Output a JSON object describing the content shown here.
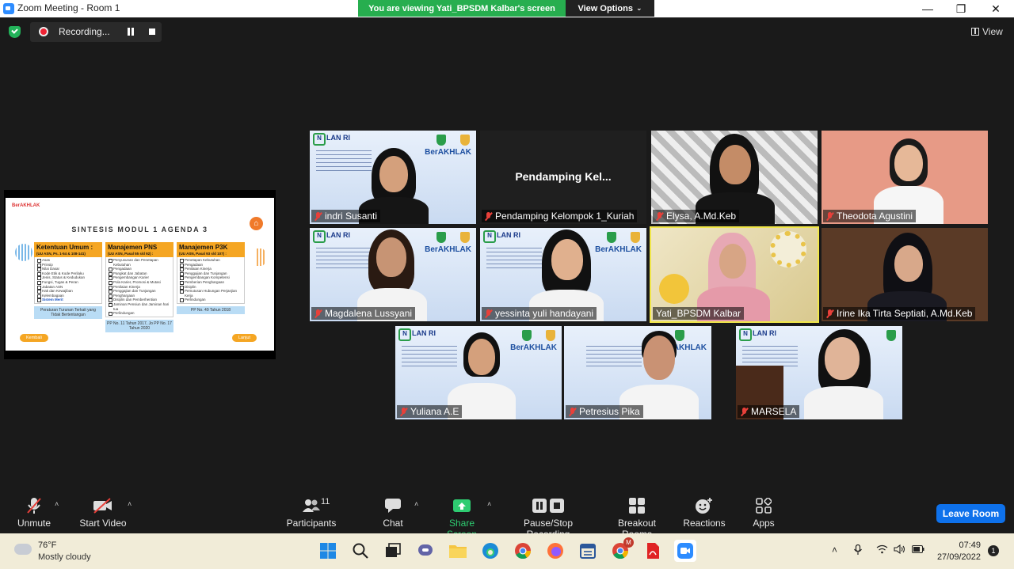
{
  "window": {
    "title": "Zoom Meeting - Room 1",
    "viewing_banner": "You are viewing Yati_BPSDM Kalbar's screen",
    "view_options": "View Options",
    "minimize": "—",
    "maximize": "❐",
    "close": "✕"
  },
  "recording": {
    "label": "Recording..."
  },
  "view_button": "View",
  "shared_slide": {
    "logo_text": "BerAKHLAK",
    "title": "SINTESIS MODUL 1 AGENDA 3",
    "columns": [
      {
        "heading": "Ketentuan Umum :",
        "subheading": "(UU ASN, Ps. 1-54 & 108-141)",
        "items": [
          "Asas",
          "Prinsip",
          "Nilai Dasar",
          "Kode Etik & Kode Perilaku",
          "Jenis, Status & Kedudukan",
          "Fungsi, Tugas & Peran",
          "Jabatan ASN",
          "Hak dan Kewajiban",
          "Kelembagaan",
          "Sistem Merit"
        ],
        "highlight": "Sistem Merit",
        "footer": "Peraturan Turunan Terkait yang Tidak Bertentangan"
      },
      {
        "heading": "Manajemen PNS",
        "subheading": "(UU ASN, Pasal 55 s/d 92) :",
        "items": [
          "Penyusunan dan Penetapan Kebutuhan",
          "Pengadaan",
          "Pangkat dan Jabatan",
          "Pengembangan Karier",
          "Pola Karier, Promosi & Mutasi",
          "Penilaian Kinerja",
          "Penggajian dan Tunjangan",
          "Penghargaan",
          "Disiplin dan Pemberhentian",
          "Jaminan Pensiun dan Jaminan hari tua",
          "Perlindungan"
        ],
        "highlight": "",
        "footer": "PP No. 11 Tahun 2017, Jo PP No. 17 Tahun 2020"
      },
      {
        "heading": "Manajemen P3K",
        "subheading": "(UU ASN, Pasal 93 s/d 107) :",
        "items": [
          "Penetapan Kebutuhan",
          "Pengadaan",
          "Penilaian Kinerja",
          "Penggajian dan Tunjangan",
          "Pengembangan Kompetensi",
          "Pemberian Penghargaan",
          "Disiplin",
          "Pemutusan Hubungan Perjanjian Kerja",
          "Perlindungan"
        ],
        "highlight": "",
        "footer": "PP No. 49 Tahun 2018"
      }
    ],
    "back_button": "Kembali",
    "next_button": "Lanjut"
  },
  "participants_tiles": [
    {
      "name": "indri Susanti"
    },
    {
      "name": "Pendamping Kelompok 1_Kuriah",
      "placeholder": "Pendamping  Kel..."
    },
    {
      "name": "Elysa, A.Md.Keb"
    },
    {
      "name": "Theodota Agustini"
    },
    {
      "name": "Magdalena Lussyani"
    },
    {
      "name": "yessinta yuli handayani"
    },
    {
      "name": "Yati_BPSDM Kalbar"
    },
    {
      "name": "Irine Ika Tirta Septiati, A.Md.Keb"
    },
    {
      "name": "Yuliana A.E"
    },
    {
      "name": "Petresius Pika"
    },
    {
      "name": "MARSELA"
    }
  ],
  "tile_banner": {
    "logo": "LAN RI",
    "brand": "BerAKHLAK"
  },
  "toolbar": {
    "unmute": "Unmute",
    "start_video": "Start Video",
    "participants": "Participants",
    "participants_count": "11",
    "chat": "Chat",
    "share_screen": "Share Screen",
    "pause_stop_recording": "Pause/Stop Recording",
    "breakout_rooms": "Breakout Rooms",
    "reactions": "Reactions",
    "apps": "Apps",
    "leave_room": "Leave Room",
    "share_color": "#2ecc71",
    "leave_color": "#0e71eb"
  },
  "taskbar": {
    "weather_temp": "76°F",
    "weather_desc": "Mostly cloudy",
    "time": "07:49",
    "date": "27/09/2022",
    "notification_count": "1",
    "chrome_badge": "M"
  }
}
